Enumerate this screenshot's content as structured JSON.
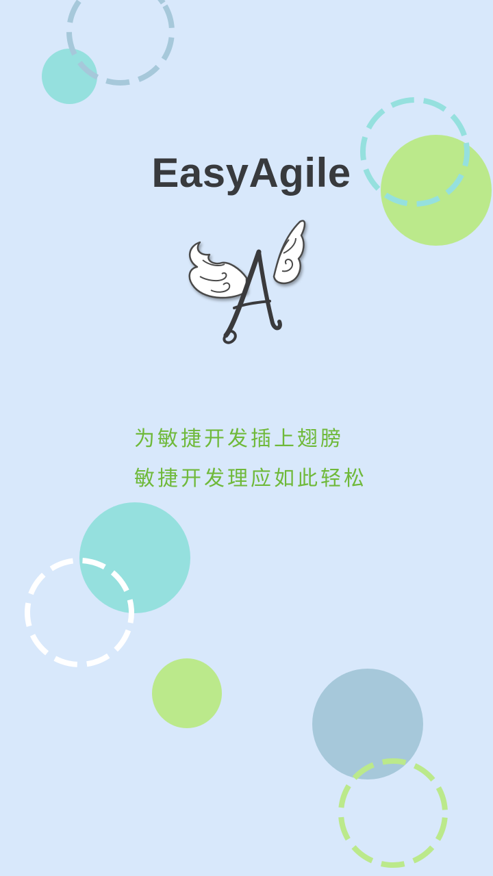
{
  "splash": {
    "app_name": "EasyAgile",
    "logo_icon": "winged-letter-a-icon",
    "tagline_line1": "为敏捷开发插上翅膀",
    "tagline_line2": "敏捷开发理应如此轻松"
  },
  "colors": {
    "background": "#d8e8fb",
    "title": "#383a3d",
    "tagline": "#6fb93a",
    "teal": "#95e0de",
    "green": "#bbe98b",
    "steel_blue": "#a6c8da",
    "dashed_white": "#ffffff"
  }
}
